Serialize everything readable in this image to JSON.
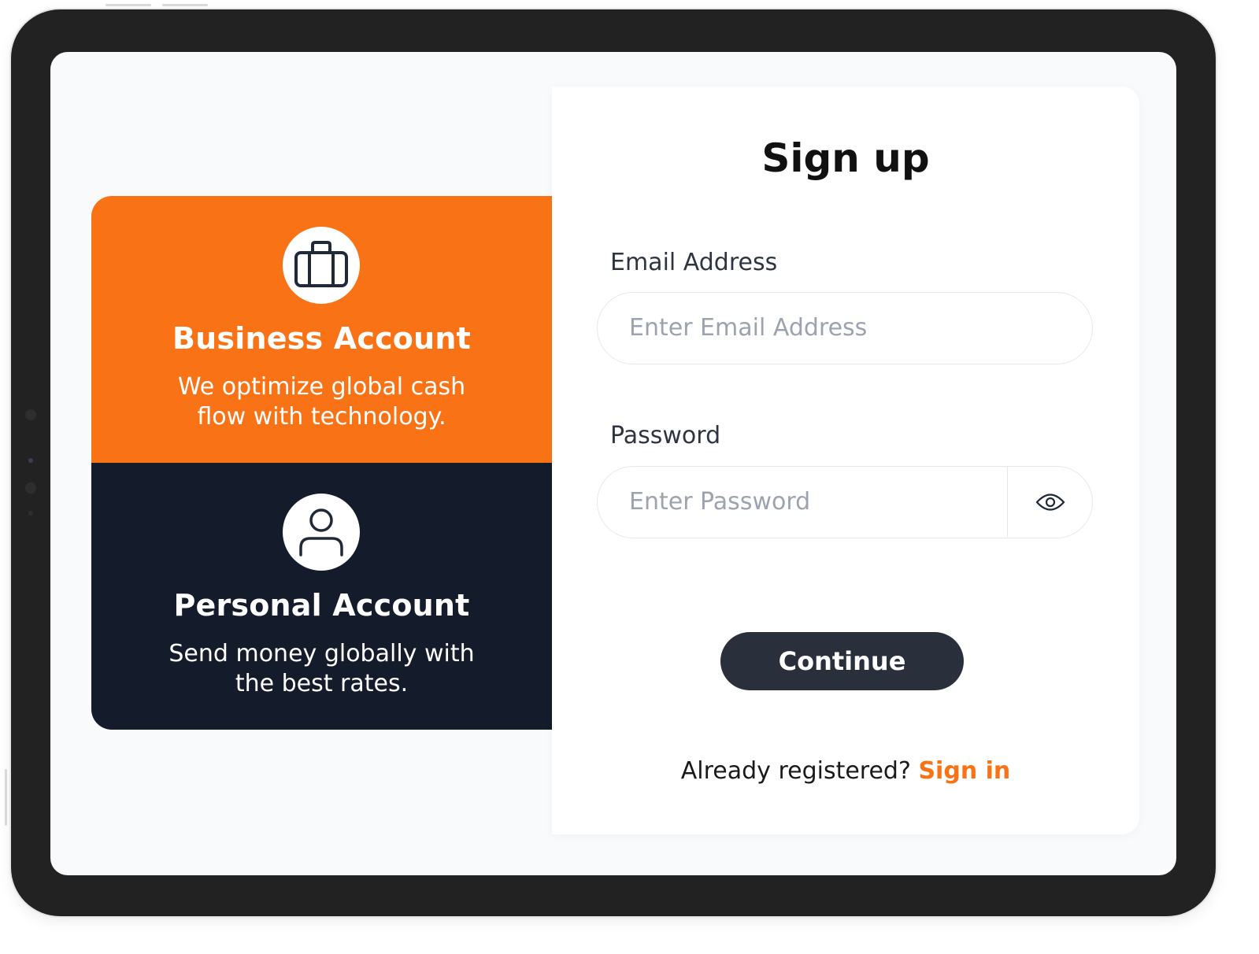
{
  "business_account": {
    "icon": "briefcase-icon",
    "title": "Business Account",
    "description": "We optimize global cash flow with technology."
  },
  "personal_account": {
    "icon": "user-icon",
    "title": "Personal Account",
    "description": "Send money globally with the best rates."
  },
  "signup": {
    "title": "Sign up",
    "email": {
      "label": "Email Address",
      "placeholder": "Enter Email Address",
      "value": ""
    },
    "password": {
      "label": "Password",
      "placeholder": "Enter Password",
      "value": "",
      "toggle_icon": "eye-icon"
    },
    "continue_label": "Continue",
    "footer_text": "Already registered?",
    "signin_label": "Sign in"
  },
  "colors": {
    "accent": "#f97316",
    "dark_panel": "#141b2b",
    "button": "#29303b",
    "device_frame": "#222222",
    "screen_bg": "#f8fafc"
  }
}
